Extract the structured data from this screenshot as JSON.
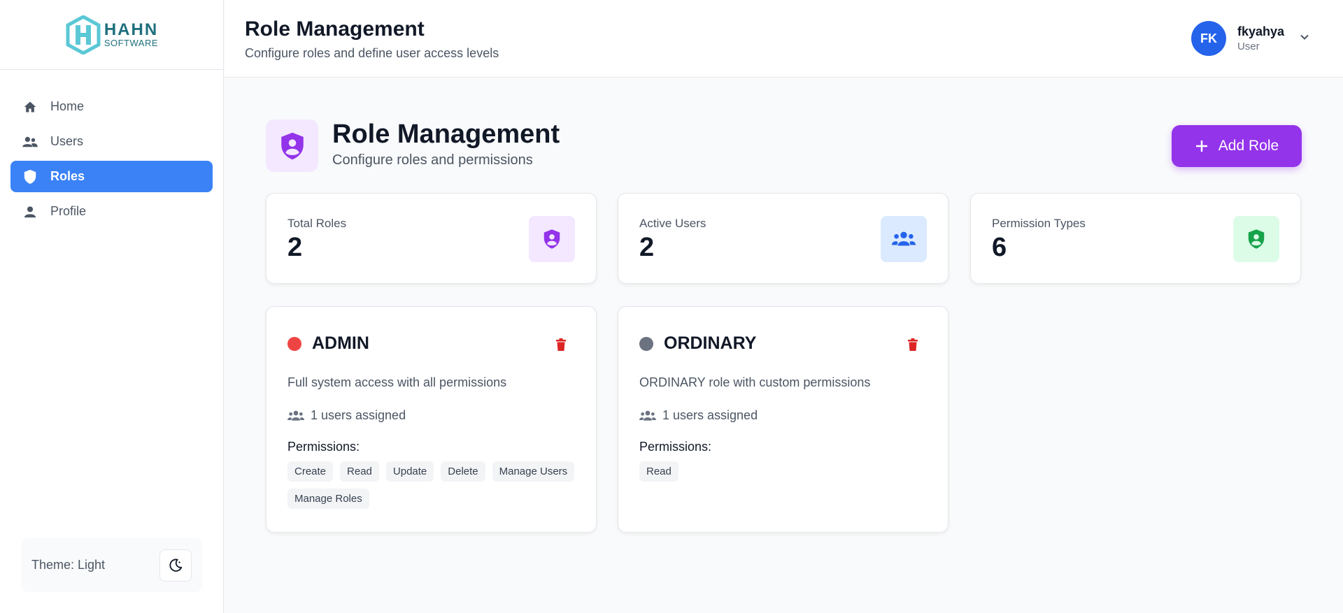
{
  "brand": {
    "line1": "HAHN",
    "line2": "SOFTWARE"
  },
  "sidebar": {
    "items": [
      {
        "label": "Home",
        "icon": "home-icon"
      },
      {
        "label": "Users",
        "icon": "users-icon"
      },
      {
        "label": "Roles",
        "icon": "shield-icon",
        "active": true
      },
      {
        "label": "Profile",
        "icon": "person-icon"
      }
    ],
    "theme_label": "Theme: Light"
  },
  "header": {
    "title": "Role Management",
    "subtitle": "Configure roles and define user access levels"
  },
  "user": {
    "initials": "FK",
    "name": "fkyahya",
    "role": "User"
  },
  "page": {
    "title": "Role Management",
    "subtitle": "Configure roles and permissions",
    "add_button": "Add Role"
  },
  "stats": [
    {
      "label": "Total Roles",
      "value": "2",
      "icon": "shield-user-icon",
      "icon_color": "#9333ea",
      "icon_bg": "#f3e8ff"
    },
    {
      "label": "Active Users",
      "value": "2",
      "icon": "users-icon",
      "icon_color": "#2563eb",
      "icon_bg": "#dbeafe"
    },
    {
      "label": "Permission Types",
      "value": "6",
      "icon": "shield-check-icon",
      "icon_color": "#16a34a",
      "icon_bg": "#dcfce7"
    }
  ],
  "roles": [
    {
      "name": "ADMIN",
      "dot_color": "#ef4444",
      "description": "Full system access with all permissions",
      "users": "1 users assigned",
      "permissions_label": "Permissions:",
      "permissions": [
        "Create",
        "Read",
        "Update",
        "Delete",
        "Manage Users",
        "Manage Roles"
      ]
    },
    {
      "name": "ORDINARY",
      "dot_color": "#6b7280",
      "description": "ORDINARY role with custom permissions",
      "users": "1 users assigned",
      "permissions_label": "Permissions:",
      "permissions": [
        "Read"
      ]
    }
  ],
  "colors": {
    "accent": "#3b82f6",
    "primary_button": "#9333ea",
    "delete": "#dc2626"
  }
}
